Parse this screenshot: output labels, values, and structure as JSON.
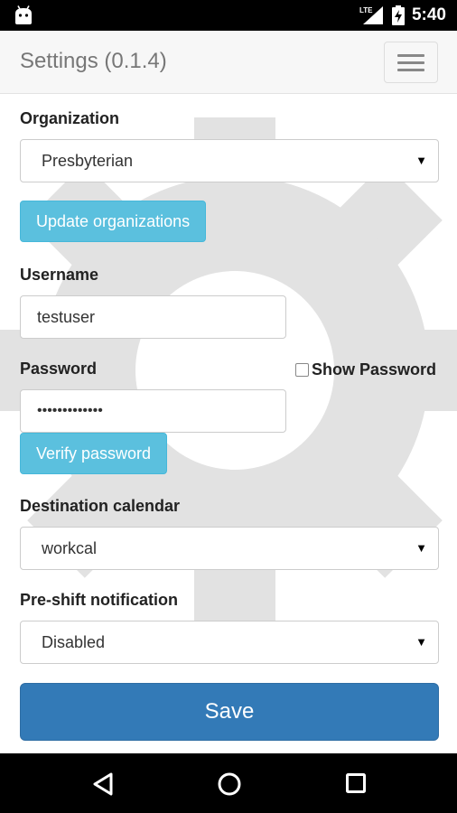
{
  "status_bar": {
    "network": "LTE",
    "time": "5:40"
  },
  "header": {
    "title": "Settings (0.1.4)",
    "menu_icon": "hamburger-menu-icon"
  },
  "form": {
    "organization": {
      "label": "Organization",
      "selected": "Presbyterian"
    },
    "update_organizations_label": "Update organizations",
    "username": {
      "label": "Username",
      "value": "testuser"
    },
    "password": {
      "label": "Password",
      "value": "•••••••••••••"
    },
    "show_password_label": "Show Password",
    "show_password_checked": false,
    "verify_password_label": "Verify password",
    "destination_calendar": {
      "label": "Destination calendar",
      "selected": "workcal"
    },
    "pre_shift_notification": {
      "label": "Pre-shift notification",
      "selected": "Disabled"
    },
    "save_label": "Save"
  },
  "nav_bar": {
    "back_icon": "back-triangle-icon",
    "home_icon": "home-circle-icon",
    "recents_icon": "recents-square-icon"
  },
  "colors": {
    "info_button": "#5bc0de",
    "primary_button": "#337ab7",
    "header_bg": "#f7f7f7"
  }
}
